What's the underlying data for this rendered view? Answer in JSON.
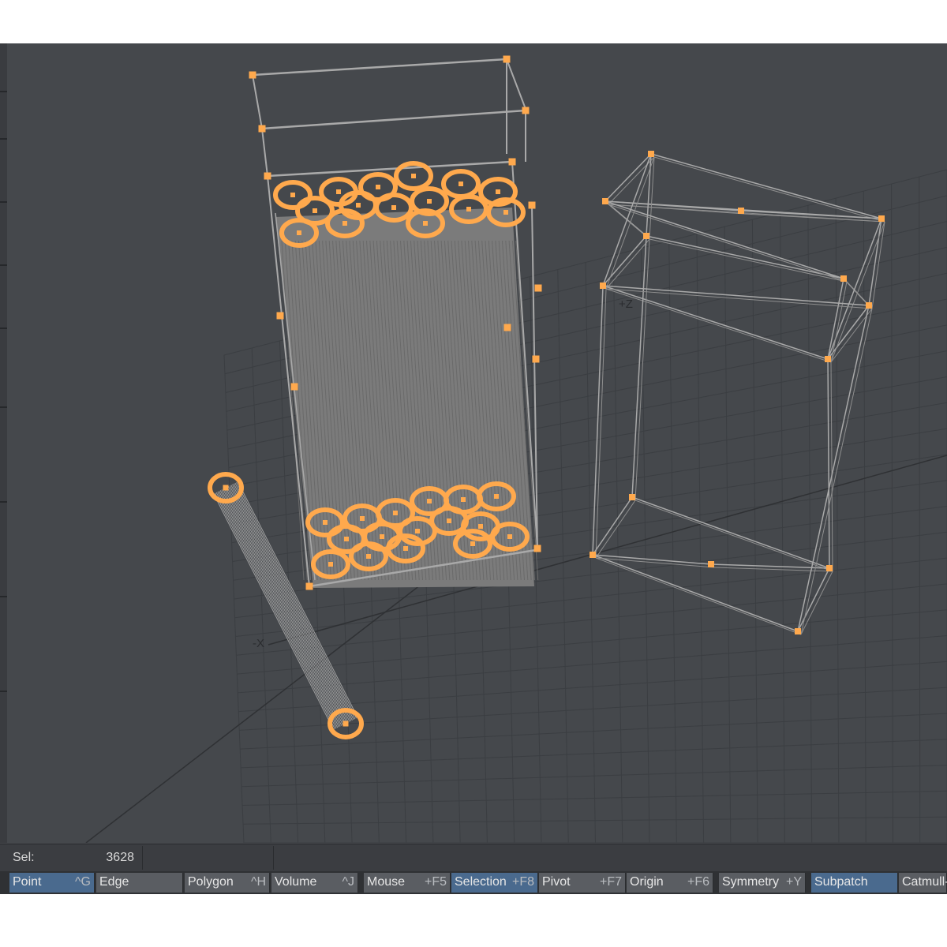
{
  "viewport": {
    "axis_labels": {
      "positive_z": "+Z",
      "negative_x": "-X"
    },
    "colors": {
      "background": "#45484c",
      "grid": "#3b3e42",
      "wire": "#a9a9a9",
      "selection": "#ffa94d",
      "fill": "#7b7b7b"
    }
  },
  "info_bar": {
    "sel_label": "Sel:",
    "sel_count": "3628"
  },
  "mode_bar": {
    "buttons": [
      {
        "label": "Point",
        "key": "^G",
        "active": true
      },
      {
        "label": "Edge",
        "key": ""
      },
      {
        "label": "Polygon",
        "key": "^H"
      },
      {
        "label": "Volume",
        "key": "^J"
      },
      {
        "label": "Mouse",
        "key": "+F5"
      },
      {
        "label": "Selection",
        "key": "+F8",
        "active": true
      },
      {
        "label": "Pivot",
        "key": "+F7"
      },
      {
        "label": "Origin",
        "key": "+F6"
      },
      {
        "label": "Symmetry",
        "key": "+Y"
      },
      {
        "label": "Subpatch",
        "key": "",
        "active": true
      },
      {
        "label": "Catmull-",
        "key": ""
      }
    ]
  }
}
